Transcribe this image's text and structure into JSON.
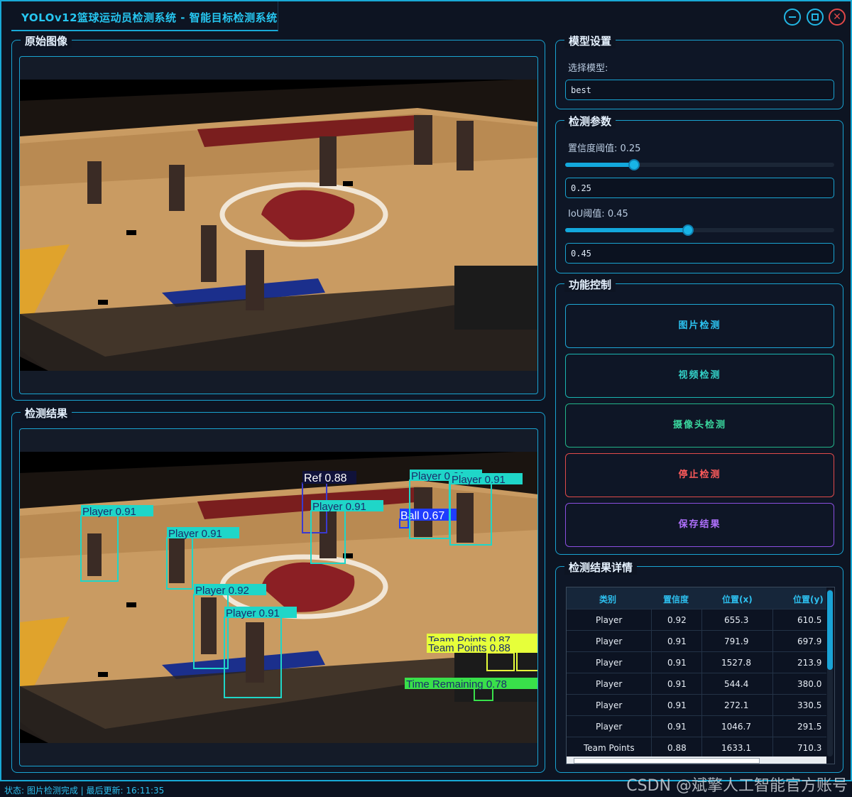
{
  "app": {
    "title": "YOLOv12篮球运动员检测系统 - 智能目标检测系统"
  },
  "panels": {
    "original_title": "原始图像",
    "result_title": "检测结果"
  },
  "detections_overlay": [
    {
      "label": "Player 0.91"
    },
    {
      "label": "Player 0.91"
    },
    {
      "label": "Player 0.92"
    },
    {
      "label": "Player 0.91"
    },
    {
      "label": "Ref 0.88"
    },
    {
      "label": "Player 0.91"
    },
    {
      "label": "Ball 0.67"
    },
    {
      "label": "Player 0.91"
    },
    {
      "label": "Player 0.91"
    },
    {
      "label": "Team Points 0.87"
    },
    {
      "label": "Team Points 0.88"
    },
    {
      "label": "Time Remaining 0.78"
    }
  ],
  "model_settings": {
    "title": "模型设置",
    "select_label": "选择模型:",
    "model_value": "best"
  },
  "detect_params": {
    "title": "检测参数",
    "conf_label": "置信度阈值: 0.25",
    "conf_value": "0.25",
    "conf_level": 0.25,
    "iou_label": "IoU阈值: 0.45",
    "iou_value": "0.45",
    "iou_level": 0.45
  },
  "controls": {
    "title": "功能控制",
    "image_detect": "图片检测",
    "video_detect": "视频检测",
    "camera_detect": "摄像头检测",
    "stop_detect": "停止检测",
    "save_result": "保存结果"
  },
  "results_table": {
    "title": "检测结果详情",
    "columns": [
      "类别",
      "置信度",
      "位置(x)",
      "位置(y)"
    ],
    "rows": [
      [
        "Player",
        "0.92",
        "655.3",
        "610.5"
      ],
      [
        "Player",
        "0.91",
        "791.9",
        "697.9"
      ],
      [
        "Player",
        "0.91",
        "1527.8",
        "213.9"
      ],
      [
        "Player",
        "0.91",
        "544.4",
        "380.0"
      ],
      [
        "Player",
        "0.91",
        "272.1",
        "330.5"
      ],
      [
        "Player",
        "0.91",
        "1046.7",
        "291.5"
      ],
      [
        "Team Points",
        "0.88",
        "1633.1",
        "710.3"
      ]
    ]
  },
  "status": {
    "text": "状态: 图片检测完成 | 最后更新: 16:11:35"
  },
  "watermark": "CSDN @斌擎人工智能官方账号",
  "colors": {
    "accent": "#18a9d6",
    "player_box": "#1fd6c8",
    "ref_box": "#3a3ad0",
    "ball_box": "#1f3cff",
    "team_points_box": "#e6ff3a",
    "time_box": "#39e04a"
  }
}
